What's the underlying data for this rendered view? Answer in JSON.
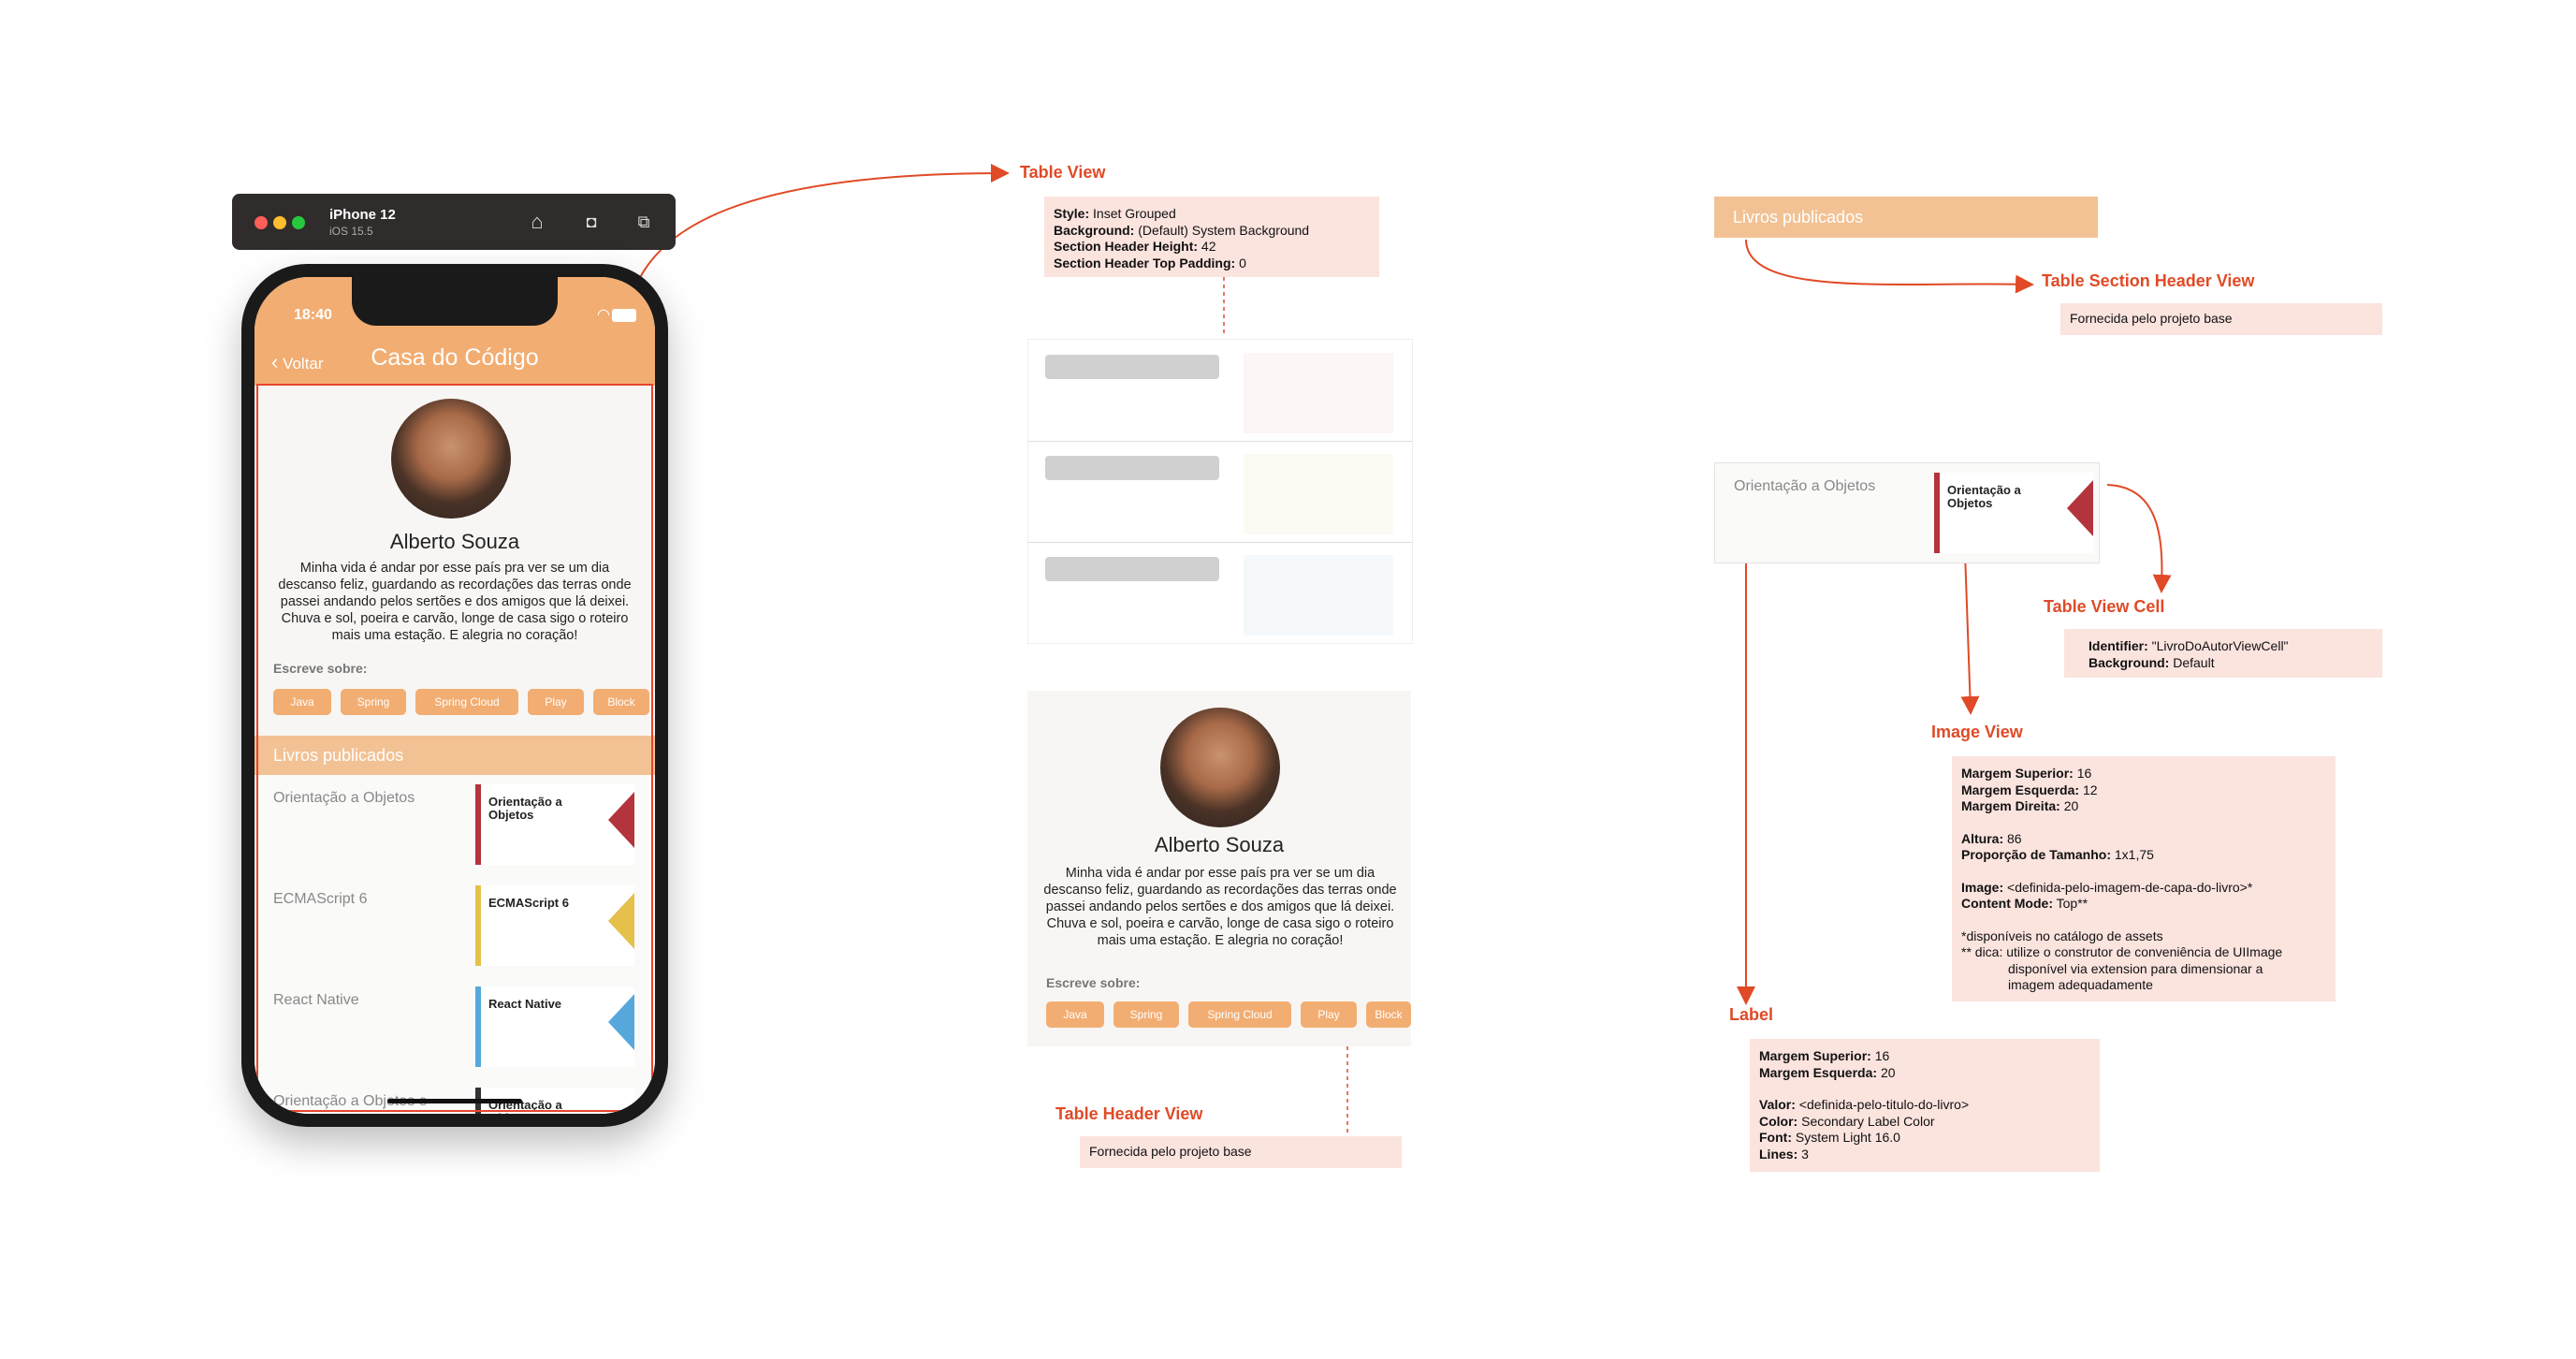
{
  "simulator": {
    "device": "iPhone 12",
    "os": "iOS 15.5",
    "icons": [
      "home-icon",
      "screenshot-icon",
      "rotate-icon"
    ]
  },
  "app": {
    "status_time": "18:40",
    "nav_back": "Voltar",
    "nav_title": "Casa do Código",
    "author_name": "Alberto Souza",
    "bio": "Minha vida é andar por esse país pra ver se um dia descanso feliz, guardando as recordações das terras onde passei andando pelos sertões e dos amigos que lá deixei. Chuva e sol, poeira e carvão, longe de casa sigo o roteiro mais uma estação. E alegria no coração!",
    "writes_about_label": "Escreve sobre:",
    "tags": [
      "Java",
      "Spring",
      "Spring Cloud",
      "Play",
      "Block"
    ],
    "section_header": "Livros publicados",
    "books": [
      {
        "title": "Orientação a Objetos",
        "cover_title": "Orientação a Objetos",
        "cover_color": "#b3343c"
      },
      {
        "title": "ECMAScript 6",
        "cover_title": "ECMAScript 6",
        "cover_color": "#e5c04b"
      },
      {
        "title": "React Native",
        "cover_title": "React Native",
        "cover_color": "#56a8dc"
      },
      {
        "title": "Orientação a Objetos e",
        "cover_title": "Orientação a Objetos",
        "cover_color": "#333333"
      }
    ]
  },
  "annotations": {
    "table_view": {
      "title": "Table View",
      "lines": [
        {
          "key": "Style:",
          "value": "Inset Grouped"
        },
        {
          "key": "Background:",
          "value": "(Default) System Background"
        },
        {
          "key": "Section Header Height:",
          "value": "42"
        },
        {
          "key": "Section Header Top Padding:",
          "value": "0"
        }
      ]
    },
    "table_header_view": {
      "title": "Table Header View",
      "note": "Fornecida pelo projeto base"
    },
    "section_header_view": {
      "title": "Table Section Header View",
      "note": "Fornecida pelo projeto base",
      "sample": "Livros publicados"
    },
    "cell": {
      "title": "Table View Cell",
      "sample_label": "Orientação a Objetos",
      "lines": [
        {
          "key": "Identifier:",
          "value": "\"LivroDoAutorViewCell\""
        },
        {
          "key": "Background:",
          "value": "Default"
        }
      ]
    },
    "image_view": {
      "title": "Image View",
      "lines": [
        {
          "key": "Margem Superior:",
          "value": "16"
        },
        {
          "key": "Margem Esquerda:",
          "value": "12"
        },
        {
          "key": "Margem Direita:",
          "value": "20"
        },
        {
          "key": "Altura:",
          "value": "86"
        },
        {
          "key": "Proporção de Tamanho:",
          "value": "1x1,75"
        },
        {
          "key": "Image:",
          "value": "<definida-pelo-imagem-de-capa-do-livro>*"
        },
        {
          "key": "Content Mode:",
          "value": "Top**"
        }
      ],
      "footnote1": "*disponíveis no catálogo de assets",
      "footnote2": "** dica: utilize o construtor de conveniência de UIImage",
      "footnote3": "disponível via extension para dimensionar a",
      "footnote4": "imagem adequadamente"
    },
    "label": {
      "title": "Label",
      "lines": [
        {
          "key": "Margem Superior:",
          "value": "16"
        },
        {
          "key": "Margem Esquerda:",
          "value": "20"
        },
        {
          "key": "Valor:",
          "value": "<definida-pelo-titulo-do-livro>"
        },
        {
          "key": "Color:",
          "value": "Secondary Label Color"
        },
        {
          "key": "Font:",
          "value": "System Light 16.0"
        },
        {
          "key": "Lines:",
          "value": "3"
        }
      ]
    }
  },
  "colors": {
    "accent": "#f2ad72",
    "annotation_red": "#e04a26",
    "annotation_bg": "#fbe3de"
  }
}
